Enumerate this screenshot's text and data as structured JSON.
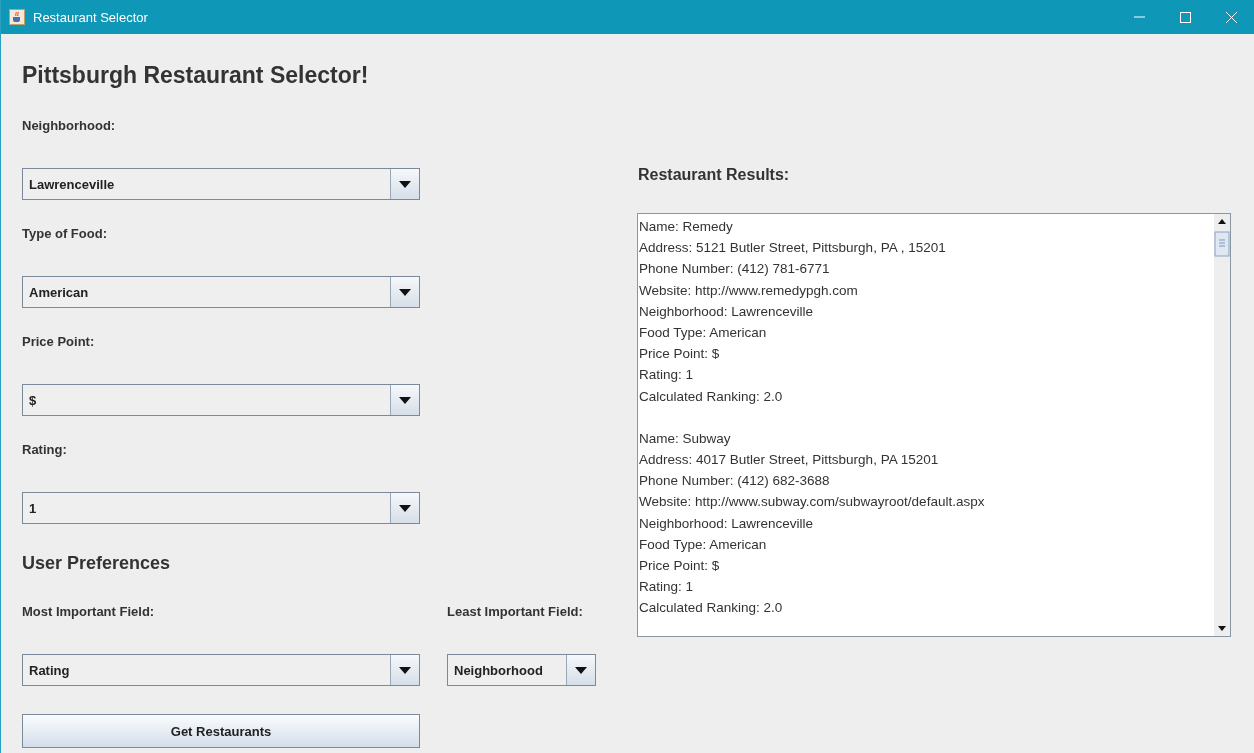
{
  "window": {
    "title": "Restaurant Selector"
  },
  "heading": "Pittsburgh Restaurant Selector!",
  "filters": [
    {
      "label": "Neighborhood:",
      "value": "Lawrenceville"
    },
    {
      "label": "Type of Food:",
      "value": "American"
    },
    {
      "label": "Price Point:",
      "value": "$"
    },
    {
      "label": "Rating:",
      "value": "1"
    }
  ],
  "preferences": {
    "title": "User Preferences",
    "most_important": {
      "label": "Most Important Field:",
      "value": "Rating"
    },
    "least_important": {
      "label": "Least Important Field:",
      "value": "Neighborhood"
    }
  },
  "submit_button": "Get Restaurants",
  "results": {
    "title": "Restaurant Results:",
    "entries": [
      {
        "lines": [
          "Name: Remedy",
          "Address: 5121 Butler Street,  Pittsburgh, PA , 15201",
          "Phone Number: (412) 781-6771",
          "Website: http://www.remedypgh.com",
          "Neighborhood: Lawrenceville",
          "Food Type: American",
          "Price Point: $",
          "Rating: 1",
          "Calculated Ranking: 2.0"
        ]
      },
      {
        "lines": [
          "Name: Subway",
          "Address: 4017 Butler Street, Pittsburgh, PA 15201",
          "Phone Number: (412) 682-3688",
          "Website: http://www.subway.com/subwayroot/default.aspx",
          "Neighborhood: Lawrenceville",
          "Food Type: American",
          "Price Point: $",
          "Rating: 1",
          "Calculated Ranking: 2.0"
        ]
      }
    ]
  }
}
